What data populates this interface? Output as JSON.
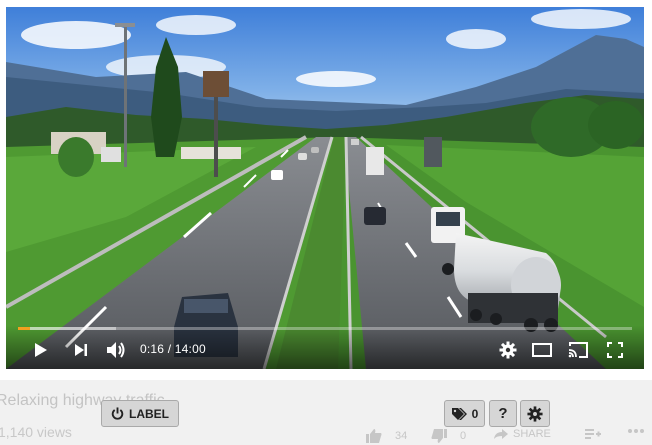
{
  "player": {
    "current_time": "0:16",
    "duration": "14:00",
    "time_separator": "/",
    "progress_fraction": 0.019,
    "buffer_fraction": 0.16,
    "accent_color": "#f0a020"
  },
  "video": {
    "title": "Relaxing highway traffic",
    "views": "1,140 views"
  },
  "actions": {
    "label_button": "LABEL",
    "tag_count": "0",
    "help_label": "?",
    "likes": "34",
    "dislikes": "0",
    "share": "SHARE"
  },
  "icons": {
    "play": "play-icon",
    "next": "next-icon",
    "volume": "volume-icon",
    "settings": "gear-icon",
    "theater": "theater-icon",
    "cast": "cast-icon",
    "fullscreen": "fullscreen-icon",
    "power": "power-icon",
    "tag": "tag-icon",
    "thumb_up": "thumb-up-icon",
    "thumb_down": "thumb-down-icon",
    "share": "share-icon",
    "add_to_playlist": "add-to-playlist-icon",
    "more": "more-icon"
  }
}
